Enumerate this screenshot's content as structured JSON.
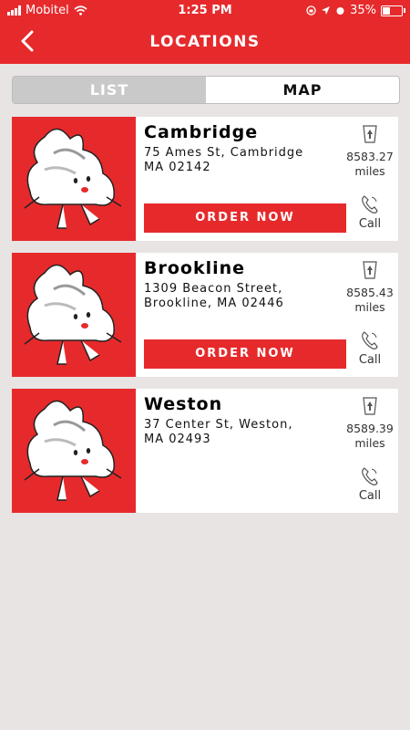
{
  "status_bar": {
    "carrier": "Mobitel",
    "time": "1:25 PM",
    "battery": "35%"
  },
  "header": {
    "title": "LOCATIONS"
  },
  "tabs": {
    "list": "LIST",
    "map": "MAP"
  },
  "locations": [
    {
      "name": "Cambridge",
      "address_line1": "75 Ames St, Cambridge",
      "address_line2": "MA 02142",
      "distance": "8583.27",
      "unit": "miles",
      "order_label": "ORDER NOW",
      "call_label": "Call"
    },
    {
      "name": "Brookline",
      "address_line1": "1309 Beacon Street,",
      "address_line2": "Brookline, MA 02446",
      "distance": "8585.43",
      "unit": "miles",
      "order_label": "ORDER NOW",
      "call_label": "Call"
    },
    {
      "name": "Weston",
      "address_line1": "37 Center St, Weston,",
      "address_line2": "MA 02493",
      "distance": "8589.39",
      "unit": "miles",
      "call_label": "Call"
    }
  ],
  "colors": {
    "brand_red": "#e62a2c",
    "background": "#e8e4e4"
  },
  "icons": [
    "back-arrow-icon",
    "wifi-icon",
    "directions-icon",
    "phone-icon",
    "mascot-dumpling"
  ]
}
